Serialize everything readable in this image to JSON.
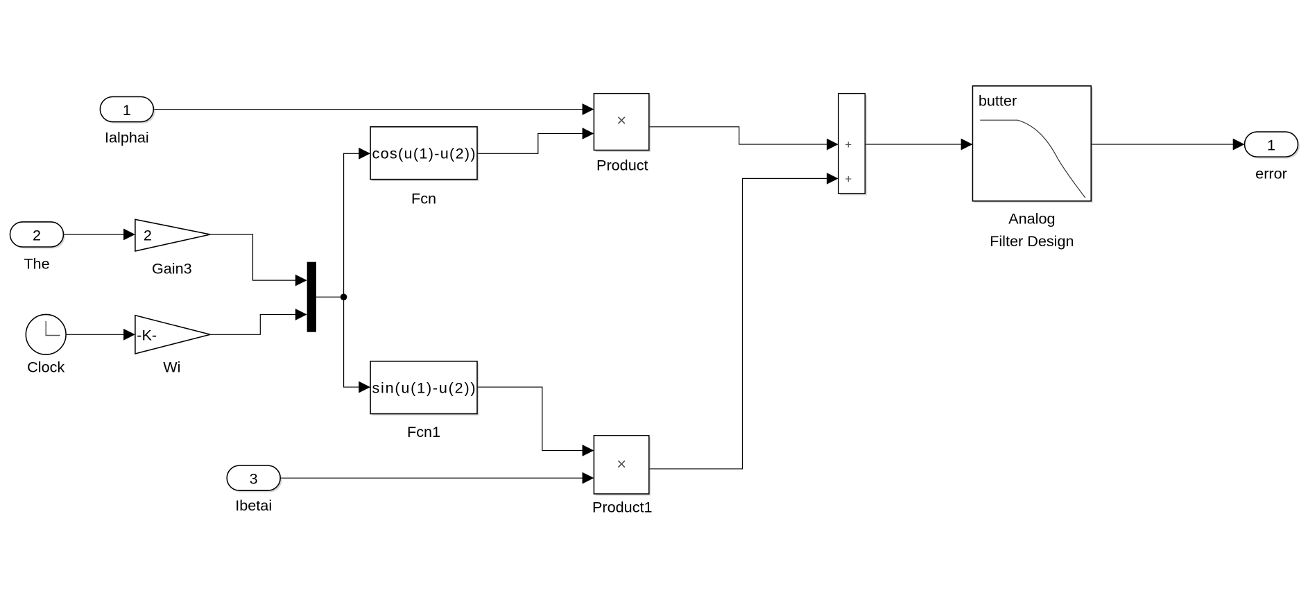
{
  "diagram": {
    "inports": [
      {
        "number": "1",
        "name": "Ialphai"
      },
      {
        "number": "2",
        "name": "The"
      },
      {
        "number": "3",
        "name": "Ibetai"
      }
    ],
    "clock": {
      "name": "Clock",
      "icon": "clock-icon"
    },
    "gain3": {
      "value": "2",
      "name": "Gain3"
    },
    "wi": {
      "value": "-K-",
      "name": "Wi"
    },
    "fcn": {
      "expr": "cos(u(1)-u(2))",
      "name": "Fcn"
    },
    "fcn1": {
      "expr": "sin(u(1)-u(2))",
      "name": "Fcn1"
    },
    "product": {
      "symbol": "×",
      "name": "Product"
    },
    "product1": {
      "symbol": "×",
      "name": "Product1"
    },
    "sum": {
      "signs": [
        "+",
        "+"
      ]
    },
    "filter": {
      "method": "butter",
      "name_line1": "Analog",
      "name_line2": "Filter Design"
    },
    "outport": {
      "number": "1",
      "name": "error"
    }
  }
}
